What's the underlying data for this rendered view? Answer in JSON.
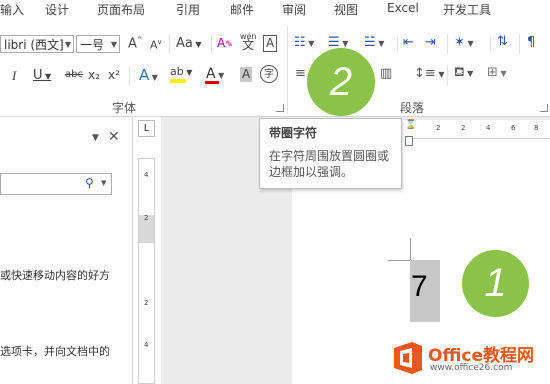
{
  "menubar": {
    "items": [
      "输入",
      "设计",
      "页面布局",
      "引用",
      "邮件",
      "审阅",
      "视图",
      "Excel",
      "开发工具"
    ]
  },
  "ribbon": {
    "font_name": "libri (西文]",
    "font_size": "一号",
    "grow_font": "A",
    "shrink_font": "A",
    "change_case": "Aa",
    "phonetic_guide": "wén",
    "char_border": "A",
    "italic": "I",
    "underline": "U",
    "strikethrough": "abc",
    "subscript": "x₂",
    "superscript": "x²",
    "text_effects": "A",
    "highlight": "ab",
    "font_color": "A",
    "char_shading": "A",
    "enclose_chars": "字",
    "group_font_label": "字体",
    "group_paragraph_label": "段落"
  },
  "tooltip": {
    "title": "带圈字符",
    "description": "在字符周围放置圆圈或边框加以强调。"
  },
  "badges": {
    "step1": "1",
    "step2": "2"
  },
  "navpane": {
    "snippet1": "或快速移动内容的好方",
    "snippet2": "选项卡，并向文档中的"
  },
  "document": {
    "character": "7"
  },
  "rulers": {
    "horizontal_ticks": [
      "2",
      "2",
      "4",
      "6",
      "8",
      "10"
    ],
    "vertical_ticks": [
      "4",
      "2",
      "2",
      "4"
    ],
    "tab_selector": "L"
  },
  "watermark": {
    "brand": "Office教程网",
    "url": "www.office26.com"
  },
  "colors": {
    "badge": "#8bc34a",
    "highlight_bar": "#ffee00",
    "font_color_bar": "#e00000",
    "doc_background": "#ececec",
    "logo_orange": "#e8571b"
  }
}
